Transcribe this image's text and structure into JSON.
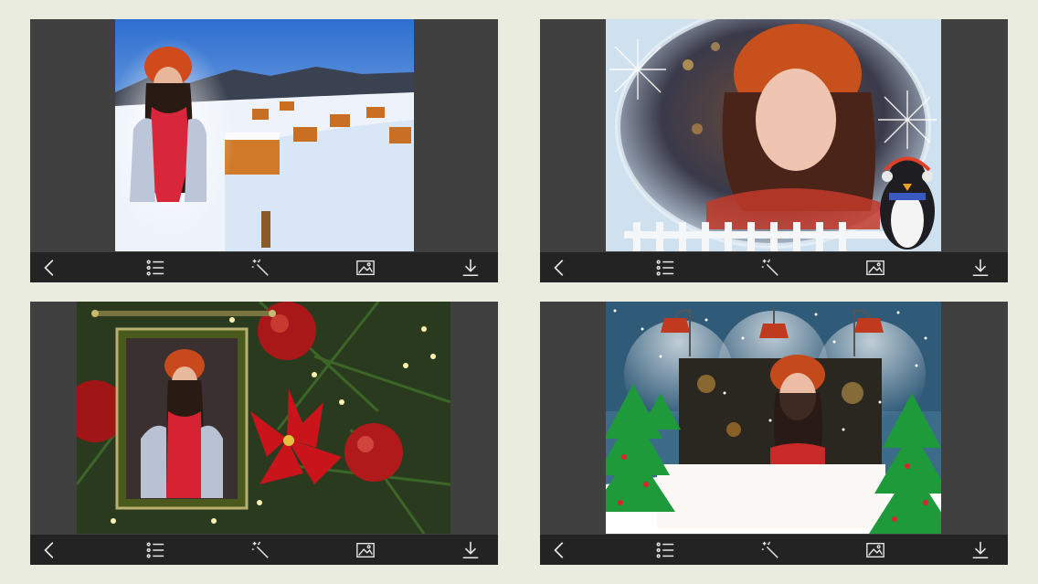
{
  "colors": {
    "background": "#e9ecdf",
    "panel": "#404040",
    "toolbar": "#232323",
    "icon": "#e8e8e8"
  },
  "icons": {
    "back": "chevron-left-icon",
    "list": "list-icon",
    "effects": "magic-wand-icon",
    "gallery": "image-icon",
    "download": "download-icon"
  },
  "panels": [
    {
      "frame": "winter-landscape-blend"
    },
    {
      "frame": "snow-globe-penguin"
    },
    {
      "frame": "christmas-tree-hanging-frame"
    },
    {
      "frame": "street-lamps-snow"
    }
  ]
}
